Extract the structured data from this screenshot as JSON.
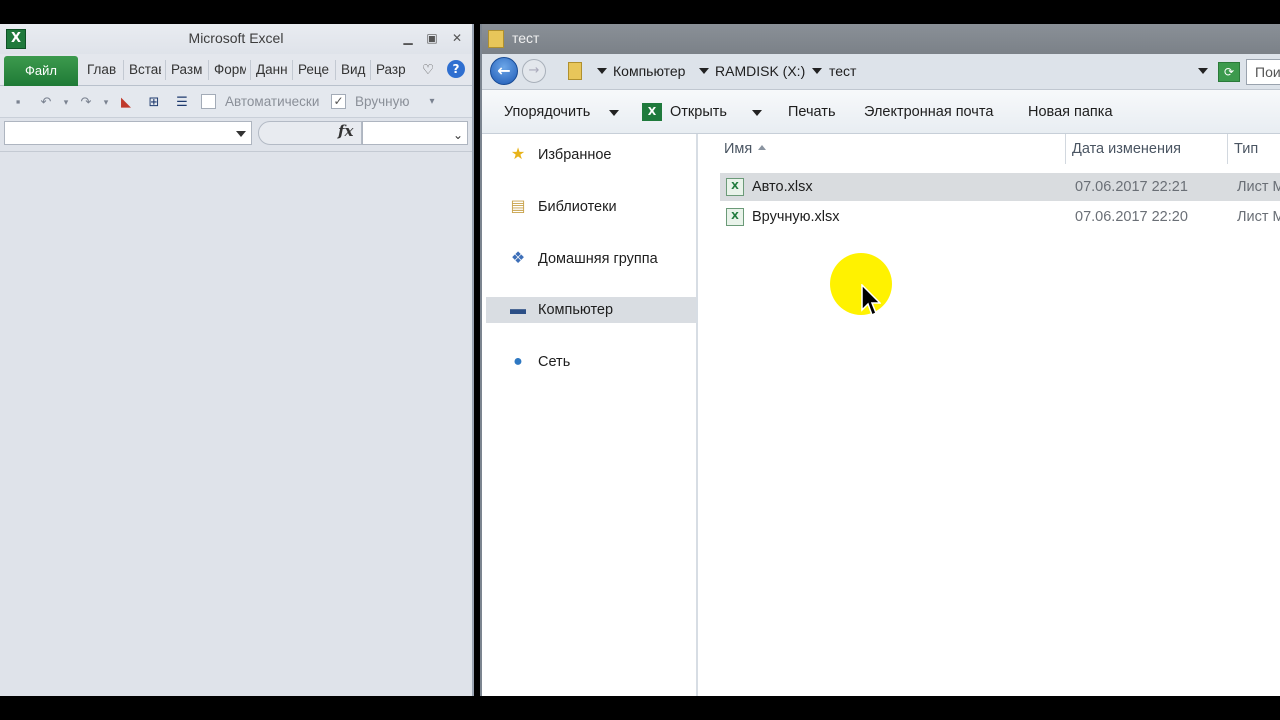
{
  "excel": {
    "title": "Microsoft Excel",
    "ribbon_tabs": [
      "Глав",
      "Встав",
      "Разм",
      "Форм",
      "Данн",
      "Реце",
      "Вид",
      "Разр"
    ],
    "file_tab": "Файл",
    "qat": {
      "auto_label": "Автоматически",
      "manual_label": "Вручную",
      "manual_checked": true
    },
    "fx_label": "fx"
  },
  "explorer": {
    "title": "тест",
    "breadcrumb": [
      "Компьютер",
      "RAMDISK (X:)",
      "тест"
    ],
    "search_placeholder": "Пои",
    "commands": {
      "organize": "Упорядочить",
      "open": "Открыть",
      "print": "Печать",
      "email": "Электронная почта",
      "new_folder": "Новая папка"
    },
    "nav": [
      {
        "label": "Избранное",
        "icon": "star-icon"
      },
      {
        "label": "Библиотеки",
        "icon": "libraries-icon"
      },
      {
        "label": "Домашняя группа",
        "icon": "homegroup-icon"
      },
      {
        "label": "Компьютер",
        "icon": "computer-icon",
        "selected": true
      },
      {
        "label": "Сеть",
        "icon": "network-icon"
      }
    ],
    "columns": {
      "name": "Имя",
      "date": "Дата изменения",
      "type": "Тип"
    },
    "files": [
      {
        "name": "Авто.xlsx",
        "date": "07.06.2017 22:21",
        "type": "Лист M",
        "selected": true
      },
      {
        "name": "Вручную.xlsx",
        "date": "07.06.2017 22:20",
        "type": "Лист M"
      }
    ]
  }
}
